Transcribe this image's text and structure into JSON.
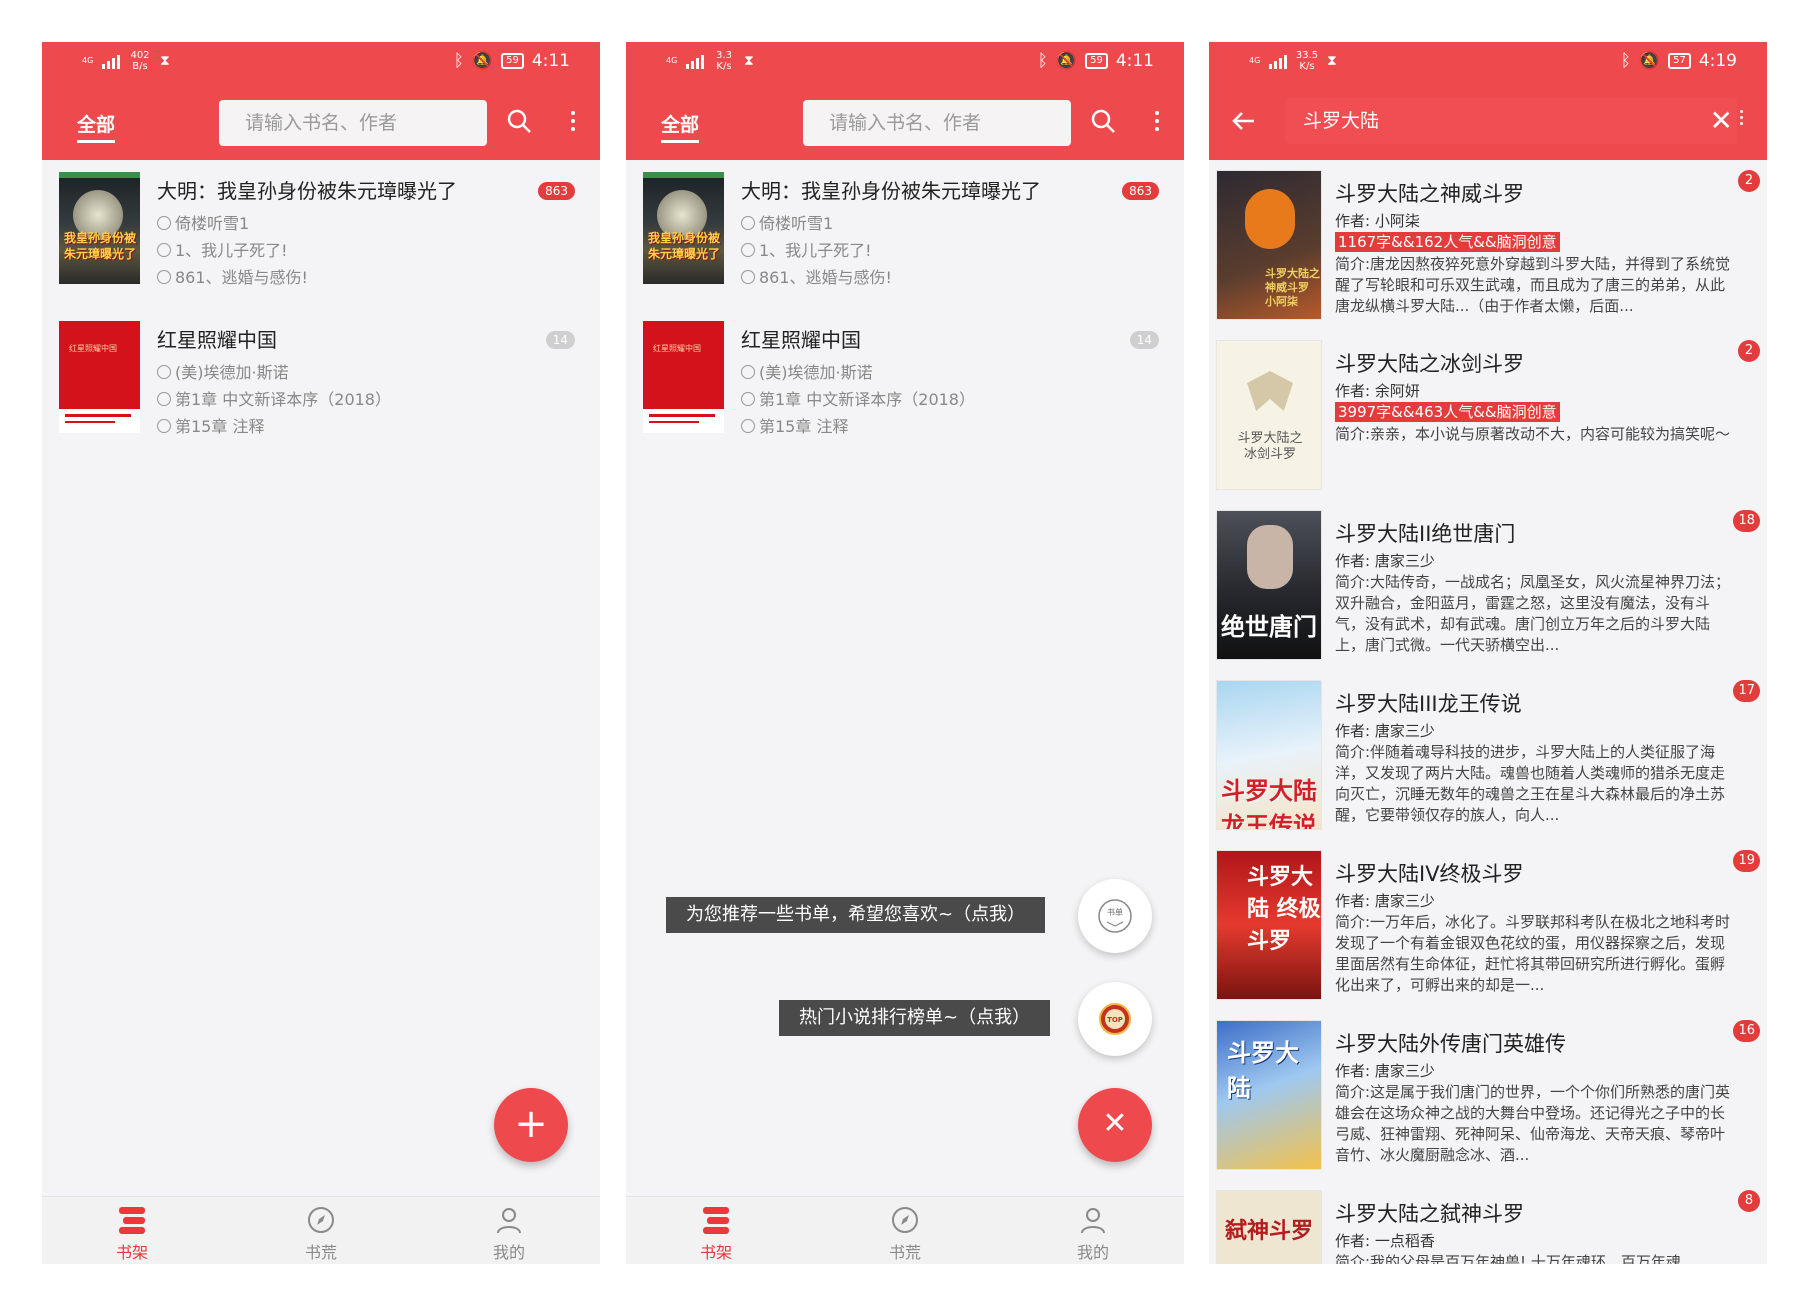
{
  "status": {
    "p1": {
      "net": "4G",
      "speed": "402\nB/s",
      "battery": "59",
      "time": "4:11"
    },
    "p2": {
      "net": "4G",
      "speed": "3.3\nK/s",
      "battery": "59",
      "time": "4:11"
    },
    "p3": {
      "net": "4G",
      "speed": "33.5\nK/s",
      "battery": "57",
      "time": "4:19"
    }
  },
  "shelf": {
    "tab_label": "全部",
    "search_placeholder": "请输入书名、作者",
    "books": [
      {
        "title": "大明：我皇孙身份被朱元璋曝光了",
        "author": "倚楼听雪1",
        "latest": "1、我儿子死了!",
        "current": "861、逃婚与感伤!",
        "unread": "863",
        "cover_text": "我皇孙身份被朱元璋曝光了"
      },
      {
        "title": "红星照耀中国",
        "author": "(美)埃德加·斯诺",
        "latest": "第1章 中文新译本序（2018）",
        "current": "第15章 注释",
        "unread": "14",
        "cover_text": "红星照耀中国"
      }
    ]
  },
  "fab": {
    "recommend_tip": "为您推荐一些书单，希望您喜欢~（点我）",
    "rank_tip": "热门小说排行榜单~（点我）",
    "recommend_icon_text": "书单",
    "rank_icon_text": "TOP"
  },
  "nav": {
    "items": [
      {
        "label": "书架"
      },
      {
        "label": "书荒"
      },
      {
        "label": "我的"
      }
    ],
    "active_color": "#e8393c"
  },
  "search": {
    "query": "斗罗大陆",
    "results": [
      {
        "title": "斗罗大陆之神威斗罗",
        "author": "作者: 小阿柒",
        "tag": "1167字&&162人气&&脑洞创意",
        "intro": "简介:唐龙因熬夜猝死意外穿越到斗罗大陆，并得到了系统觉醒了写轮眼和可乐双生武魂，而且成为了唐三的弟弟，从此唐龙纵横斗罗大陆...（由于作者太懒，后面...",
        "count": "2",
        "cover_text": "斗罗大陆之神威斗罗 小阿柒"
      },
      {
        "title": "斗罗大陆之冰剑斗罗",
        "author": "作者: 余阿妍",
        "tag": "3997字&&463人气&&脑洞创意",
        "intro": "简介:亲亲，本小说与原著改动不大，内容可能较为搞笑呢～",
        "count": "2",
        "cover_text": "斗罗大陆之冰剑斗罗"
      },
      {
        "title": "斗罗大陆II绝世唐门",
        "author": "作者: 唐家三少",
        "tag": "",
        "intro": "简介:大陆传奇，一战成名；凤凰圣女，风火流星神界刀法；双升融合，金阳蓝月，雷霆之怒，这里没有魔法，没有斗气，没有武术，却有武魂。唐门创立万年之后的斗罗大陆上，唐门式微。一代天骄横空出...",
        "count": "18",
        "cover_text": "绝世唐门"
      },
      {
        "title": "斗罗大陆III龙王传说",
        "author": "作者: 唐家三少",
        "tag": "",
        "intro": "简介:伴随着魂导科技的进步，斗罗大陆上的人类征服了海洋，又发现了两片大陆。魂兽也随着人类魂师的猎杀无度走向灭亡，沉睡无数年的魂兽之王在星斗大森林最后的净土苏醒，它要带领仅存的族人，向人...",
        "count": "17",
        "cover_text": "斗罗大陆 龙王传说"
      },
      {
        "title": "斗罗大陆IV终极斗罗",
        "author": "作者: 唐家三少",
        "tag": "",
        "intro": "简介:一万年后，冰化了。斗罗联邦科考队在极北之地科考时发现了一个有着金银双色花纹的蛋，用仪器探察之后，发现里面居然有生命体征，赶忙将其带回研究所进行孵化。蛋孵化出来了，可孵出来的却是一...",
        "count": "19",
        "cover_text": "斗罗大陆 终极斗罗"
      },
      {
        "title": "斗罗大陆外传唐门英雄传",
        "author": "作者: 唐家三少",
        "tag": "",
        "intro": "简介:这是属于我们唐门的世界，一个个你们所熟悉的唐门英雄会在这场众神之战的大舞台中登场。还记得光之子中的长弓威、狂神雷翔、死神阿呆、仙帝海龙、天帝天痕、琴帝叶音竹、冰火魔厨融念冰、酒...",
        "count": "16",
        "cover_text": "斗罗大陆"
      },
      {
        "title": "斗罗大陆之弑神斗罗",
        "author": "作者: 一点稻香",
        "tag": "",
        "intro": "简介:我的父母是百万年神兽! 十万年魂环，百万年魂...",
        "count": "8",
        "cover_text": "弑神斗罗"
      }
    ]
  }
}
